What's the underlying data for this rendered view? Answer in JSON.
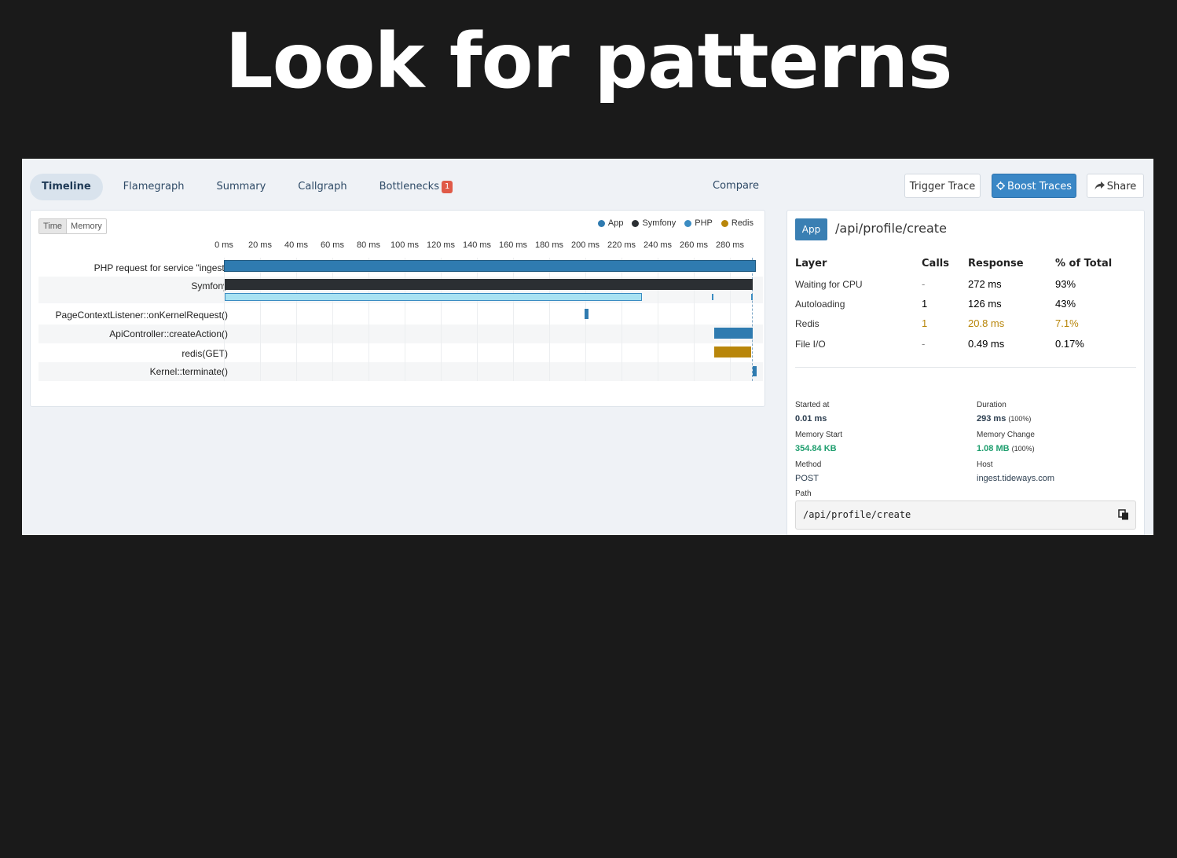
{
  "slide": {
    "title": "Look for patterns"
  },
  "tabs": [
    {
      "label": "Timeline",
      "active": true
    },
    {
      "label": "Flamegraph"
    },
    {
      "label": "Summary"
    },
    {
      "label": "Callgraph"
    },
    {
      "label": "Bottlenecks",
      "badge": "1"
    }
  ],
  "compare_label": "Compare",
  "buttons": {
    "trigger": "Trigger Trace",
    "boost": "Boost Traces",
    "share": "Share"
  },
  "timeline": {
    "toggle": [
      "Time",
      "Memory"
    ],
    "legend": [
      {
        "label": "App",
        "color": "#2f7bb0"
      },
      {
        "label": "Symfony",
        "color": "#2b2f33"
      },
      {
        "label": "PHP",
        "color": "#3b8cc2"
      },
      {
        "label": "Redis",
        "color": "#b8860b"
      }
    ],
    "ticks": [
      "0 ms",
      "20 ms",
      "40 ms",
      "60 ms",
      "80 ms",
      "100 ms",
      "120 ms",
      "140 ms",
      "160 ms",
      "180 ms",
      "200 ms",
      "220 ms",
      "240 ms",
      "260 ms",
      "280 ms"
    ],
    "rows": [
      {
        "label": "PHP request for service \"ingest\""
      },
      {
        "label": "Symfony"
      },
      {
        "label": "PageContextListener::onKernelRequest()"
      },
      {
        "label": "ApiController::createAction()"
      },
      {
        "label": "redis(GET)"
      },
      {
        "label": "Kernel::terminate()"
      }
    ]
  },
  "side": {
    "tag": "App",
    "route": "/api/profile/create",
    "headers": {
      "layer": "Layer",
      "calls": "Calls",
      "response": "Response",
      "pct": "% of Total"
    },
    "layers": [
      {
        "name": "Waiting for CPU",
        "calls": "-",
        "response": "272 ms",
        "pct": "93%"
      },
      {
        "name": "Autoloading",
        "calls": "1",
        "response": "126 ms",
        "pct": "43%"
      },
      {
        "name": "Redis",
        "calls": "1",
        "response": "20.8 ms",
        "pct": "7.1%"
      },
      {
        "name": "File I/O",
        "calls": "-",
        "response": "0.49 ms",
        "pct": "0.17%"
      }
    ],
    "meta": {
      "started_label": "Started at",
      "started": "0.01 ms",
      "duration_label": "Duration",
      "duration": "293 ms",
      "duration_pct": "(100%)",
      "mem_start_label": "Memory Start",
      "mem_start": "354.84 KB",
      "mem_change_label": "Memory Change",
      "mem_change": "1.08 MB",
      "mem_change_pct": "(100%)",
      "method_label": "Method",
      "method": "POST",
      "host_label": "Host",
      "host": "ingest.tideways.com",
      "path_label": "Path",
      "path": "/api/profile/create"
    }
  }
}
